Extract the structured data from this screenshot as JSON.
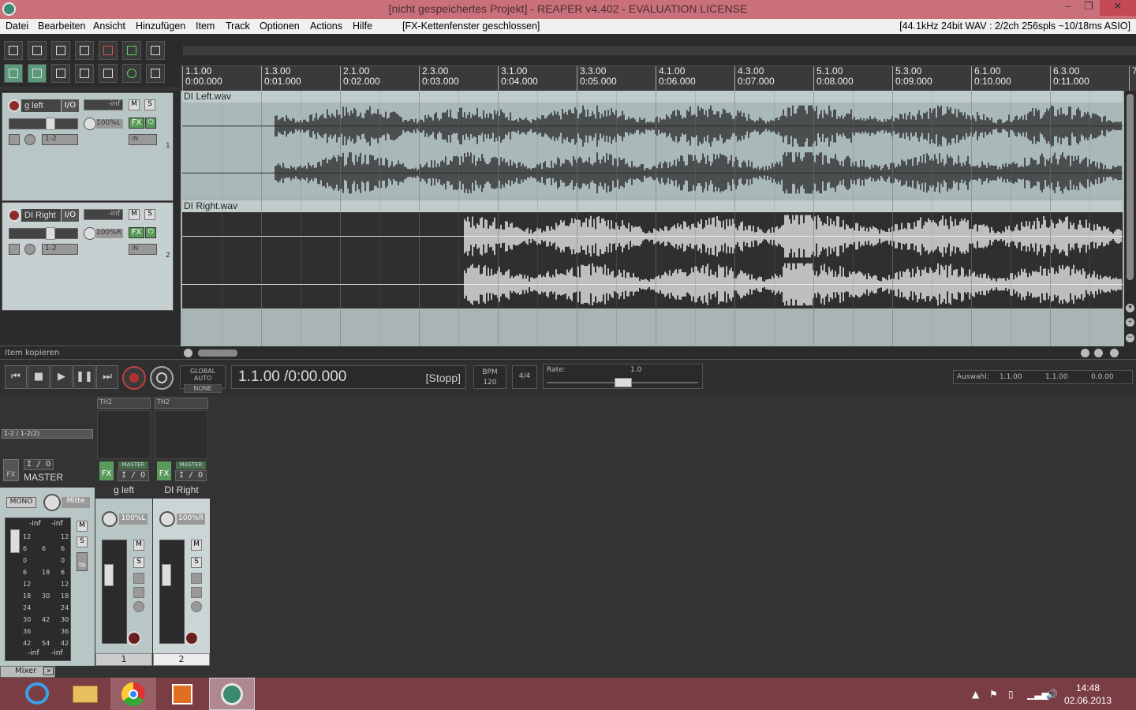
{
  "window": {
    "title": "[nicht gespeichertes Projekt] - REAPER v4.402 - EVALUATION LICENSE",
    "min": "–",
    "max": "❐",
    "close": "✕"
  },
  "menu": {
    "items": [
      "Datei",
      "Bearbeiten",
      "Ansicht",
      "Hinzufügen",
      "Item",
      "Track",
      "Optionen",
      "Actions",
      "Hilfe"
    ],
    "status": "[FX-Kettenfenster geschlossen]",
    "audio_info": "[44.1kHz 24bit WAV : 2/2ch 256spls ~10/18ms ASIO]"
  },
  "ruler": {
    "marks": [
      {
        "bar": "1.1.00",
        "time": "0:00.000"
      },
      {
        "bar": "1.3.00",
        "time": "0:01.000"
      },
      {
        "bar": "2.1.00",
        "time": "0:02.000"
      },
      {
        "bar": "2.3.00",
        "time": "0:03.000"
      },
      {
        "bar": "3.1.00",
        "time": "0:04.000"
      },
      {
        "bar": "3.3.00",
        "time": "0:05.000"
      },
      {
        "bar": "4.1.00",
        "time": "0:06.000"
      },
      {
        "bar": "4.3.00",
        "time": "0:07.000"
      },
      {
        "bar": "5.1.00",
        "time": "0:08.000"
      },
      {
        "bar": "5.3.00",
        "time": "0:09.000"
      },
      {
        "bar": "6.1.00",
        "time": "0:10.000"
      },
      {
        "bar": "6.3.00",
        "time": "0:11.000"
      },
      {
        "bar": "7",
        "time": ""
      }
    ]
  },
  "tracks": [
    {
      "name": "g left",
      "io": "I/O",
      "vu": "-inf",
      "mute": "M",
      "solo": "S",
      "pan": "100%L",
      "fx": "FX",
      "channels": "1-2",
      "in": "IN",
      "number": "1",
      "item": "DI Left.wav"
    },
    {
      "name": "DI Right",
      "io": "I/O",
      "vu": "-inf",
      "mute": "M",
      "solo": "S",
      "pan": "100%R",
      "fx": "FX",
      "channels": "1-2",
      "in": "IN",
      "number": "2",
      "item": "DI Right.wav"
    }
  ],
  "tcp_status": "Item kopieren",
  "transport": {
    "global_auto": "GLOBAL AUTO",
    "global_auto_mode": "NONE",
    "time": "1.1.00 /0:00.000",
    "state": "[Stopp]",
    "bpm_label": "BPM",
    "bpm": "120",
    "time_sig": "4/4",
    "rate_label": "Rate:",
    "rate": "1.0",
    "selection_label": "Auswahl:",
    "sel_start": "1.1.00",
    "sel_end": "1.1.00",
    "sel_len": "0.0.00"
  },
  "mixer": {
    "master": {
      "routing": "1-2 / 1-2(2)",
      "io": "I / O",
      "fx": "FX",
      "name": "MASTER",
      "mono": "MONO",
      "pan": "Mitte",
      "mute": "M",
      "solo": "S",
      "tr": "TR",
      "meter_top": [
        "-inf",
        "-inf"
      ],
      "meter_bottom": [
        "-inf",
        "-inf"
      ],
      "scale_left": [
        "12",
        "6",
        "0",
        "6",
        "12",
        "18",
        "24",
        "30",
        "36",
        "42"
      ],
      "scale_mid": [
        "6",
        "18",
        "30",
        "42",
        "54"
      ]
    },
    "strips": [
      {
        "slot": "TH2",
        "fx": "FX",
        "master": "MASTER",
        "io": "I / O",
        "name": "g left",
        "pan": "100%L",
        "mute": "M",
        "solo": "S",
        "number": "1"
      },
      {
        "slot": "TH2",
        "fx": "FX",
        "master": "MASTER",
        "io": "I / O",
        "name": "DI Right",
        "pan": "100%R",
        "mute": "M",
        "solo": "S",
        "number": "2"
      }
    ],
    "tab": "Mixer"
  },
  "taskbar": {
    "time": "14:48",
    "date": "02.06.2013"
  },
  "colors": {
    "title_bg": "#c9707a",
    "track_bg": "#b9c6c6",
    "item_light": "#a9b8b8",
    "item_dark": "#2f2f2f",
    "taskbar": "#7a3d44"
  }
}
